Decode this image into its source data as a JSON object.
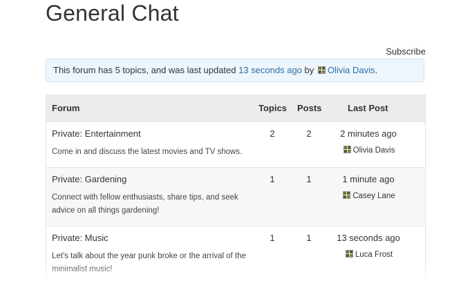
{
  "page": {
    "title": "General Chat",
    "subscribe_label": "Subscribe"
  },
  "notice": {
    "prefix": "This forum has 5 topics, and was last updated",
    "updated": "13 seconds ago",
    "by": "by",
    "user": "Olivia Davis",
    "suffix": "."
  },
  "table": {
    "headers": {
      "forum": "Forum",
      "topics": "Topics",
      "posts": "Posts",
      "last_post": "Last Post"
    },
    "rows": [
      {
        "name": "Private: Entertainment",
        "description": "Come in and discuss the latest movies and TV shows.",
        "topics": "2",
        "posts": "2",
        "last_time": "2 minutes ago",
        "last_user": "Olivia Davis"
      },
      {
        "name": "Private: Gardening",
        "description": "Connect with fellow enthusiasts, share tips, and seek advice on all things gardening!",
        "topics": "1",
        "posts": "1",
        "last_time": "1 minute ago",
        "last_user": "Casey Lane"
      },
      {
        "name": "Private: Music",
        "description": "Let's talk about the year punk broke or the arrival of the minimalist music!",
        "topics": "1",
        "posts": "1",
        "last_time": "13 seconds ago",
        "last_user": "Luca Frost"
      }
    ]
  }
}
